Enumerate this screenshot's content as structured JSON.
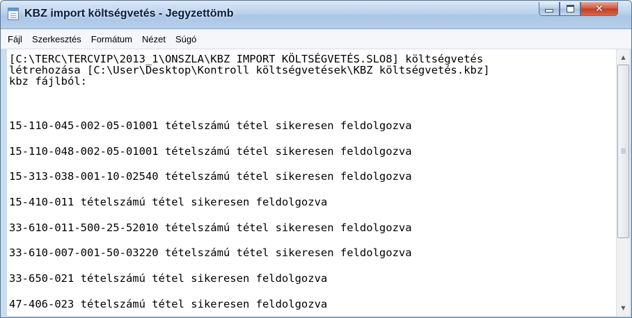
{
  "window": {
    "title": "KBZ import költségvetés - Jegyzettömb",
    "controls": {
      "minimize_icon": "minimize-icon",
      "maximize_icon": "maximize-icon",
      "close_icon": "close-icon",
      "close_glyph": "✕"
    }
  },
  "menu": {
    "items": [
      "Fájl",
      "Szerkesztés",
      "Formátum",
      "Nézet",
      "Súgó"
    ]
  },
  "editor": {
    "lines": [
      "[C:\\TERC\\TERCVIP\\2013_1\\ONSZLA\\KBZ IMPORT KÖLTSÉGVETÉS.SLO8] költségvetés",
      "létrehozása [C:\\User\\Desktop\\Kontroll költségvetések\\KBZ költségvetés.kbz]",
      "kbz fájlból:",
      "15-110-045-002-05-01001 tételszámú tétel sikeresen feldolgozva",
      "15-110-048-002-05-01001 tételszámú tétel sikeresen feldolgozva",
      "15-313-038-001-10-02540 tételszámú tétel sikeresen feldolgozva",
      "15-410-011 tételszámú tétel sikeresen feldolgozva",
      "33-610-011-500-25-52010 tételszámú tétel sikeresen feldolgozva",
      "33-610-007-001-50-03220 tételszámú tétel sikeresen feldolgozva",
      "33-650-021 tételszámú tétel sikeresen feldolgozva",
      "47-406-023 tételszámú tétel sikeresen feldolgozva"
    ]
  },
  "scrollbar": {
    "up_glyph": "▲",
    "down_glyph": "▼"
  }
}
